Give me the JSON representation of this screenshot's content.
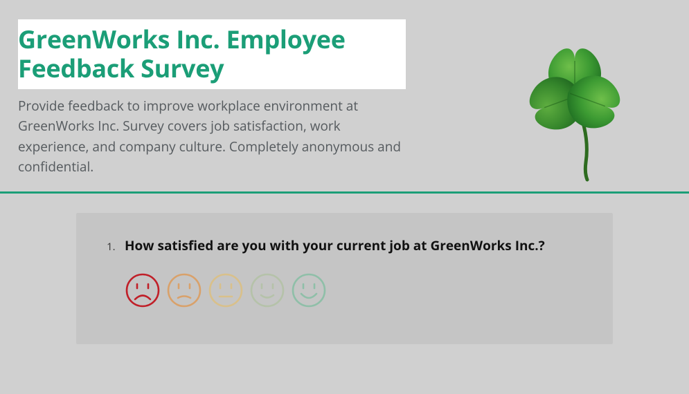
{
  "survey": {
    "title": "GreenWorks Inc. Employee Feedback Survey",
    "description": "Provide feedback to improve workplace environment at GreenWorks Inc. Survey covers job satisfaction, work experience, and company culture. Completely anonymous and confidential.",
    "logo": "shamrock"
  },
  "question": {
    "number": "1.",
    "text": "How satisfied are you with your current job at GreenWorks Inc.?",
    "rating": {
      "options": [
        {
          "label": "very-unsatisfied",
          "face": "frown",
          "color": "#c01f28"
        },
        {
          "label": "unsatisfied",
          "face": "slight-frown",
          "color": "#d9a16a"
        },
        {
          "label": "neutral",
          "face": "neutral",
          "color": "#d9c08a"
        },
        {
          "label": "satisfied",
          "face": "slight-smile",
          "color": "#b5c2a9"
        },
        {
          "label": "very-satisfied",
          "face": "smile",
          "color": "#8fbfa8"
        }
      ]
    }
  },
  "colors": {
    "accent": "#1b9e77",
    "page_bg": "#d0d0d0",
    "card_bg": "#c5c5c5",
    "title_bg": "#ffffff"
  }
}
